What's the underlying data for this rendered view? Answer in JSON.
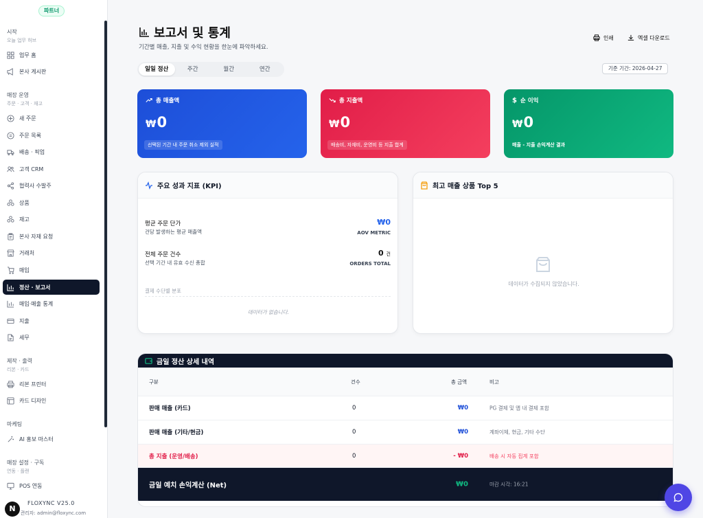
{
  "sidebar": {
    "badge": "파트너",
    "sections": [
      {
        "title": "시작",
        "sub": "오늘 업무 허브"
      },
      {
        "title": "매장 운영",
        "sub": "주문 · 고객 · 재고"
      },
      {
        "title": "제작 · 출력",
        "sub": "리본 · 카드"
      },
      {
        "title": "마케팅",
        "sub": ""
      },
      {
        "title": "매장 설정 · 구독",
        "sub": "연동 · 플랜"
      }
    ],
    "items": [
      {
        "label": "업무 홈",
        "icon": "grid-icon"
      },
      {
        "label": "본사 게시판",
        "icon": "megaphone-icon"
      },
      {
        "label": "새 주문",
        "icon": "plus-circle-icon"
      },
      {
        "label": "주문 목록",
        "icon": "list-icon"
      },
      {
        "label": "배송 · 픽업",
        "icon": "truck-icon"
      },
      {
        "label": "고객 CRM",
        "icon": "users-icon"
      },
      {
        "label": "협력사 수발주",
        "icon": "share-icon"
      },
      {
        "label": "상품",
        "icon": "boxes-icon"
      },
      {
        "label": "재고",
        "icon": "boxes-icon"
      },
      {
        "label": "본사 자재 요청",
        "icon": "clipboard-icon"
      },
      {
        "label": "거래처",
        "icon": "store-icon"
      },
      {
        "label": "매입",
        "icon": "cart-icon"
      },
      {
        "label": "정산 · 보고서",
        "icon": "bar-chart-icon"
      },
      {
        "label": "매입·매출 통계",
        "icon": "bar-chart-icon"
      },
      {
        "label": "지출",
        "icon": "card-icon"
      },
      {
        "label": "세무",
        "icon": "file-icon"
      },
      {
        "label": "리본 프린터",
        "icon": "printer-icon"
      },
      {
        "label": "카드 디자인",
        "icon": "layout-icon"
      },
      {
        "label": "AI 홍보 마스터",
        "icon": "sparkle-icon"
      },
      {
        "label": "POS 연동",
        "icon": "monitor-icon"
      }
    ],
    "active_index": 12,
    "version": "FLOXYNC V25.0",
    "admin": "관리자: admin@floxync.com",
    "logo_letter": "N"
  },
  "header": {
    "title": "보고서 및 통계",
    "subtitle": "기간별 매출, 지출 및 수익 현황을 한눈에 파악하세요.",
    "print_label": "인쇄",
    "excel_label": "엑셀 다운로드",
    "tabs": [
      "일일 정산",
      "주간",
      "월간",
      "연간"
    ],
    "active_tab": 0,
    "base_date": "기준 기간: 2026-04-27"
  },
  "kpis": [
    {
      "title": "총 매출액",
      "currency": "₩",
      "value": "0",
      "note": "선택된 기간 내 주문 취소 제외 실적",
      "color": "#1d4ed8"
    },
    {
      "title": "총 지출액",
      "currency": "₩",
      "value": "0",
      "note": "배송비, 자재비, 운영비 등 지출 합계",
      "color": "#e11d48"
    },
    {
      "title": "순 이익",
      "currency": "₩",
      "value": "0",
      "note": "매출 - 지출 손익계산 결과",
      "color": "#059669"
    }
  ],
  "kpi_card": {
    "title": "주요 성과 지표 (KPI)",
    "avg_label": "평균 주문 단가",
    "avg_sub": "건당 발생하는 평균 매출액",
    "avg_value": "₩0",
    "avg_unit": "AOV METRIC",
    "orders_label": "전체 주문 건수",
    "orders_sub": "선택 기간 내 유효 수신 총합",
    "orders_value": "0",
    "orders_suffix": "건",
    "orders_unit": "ORDERS TOTAL",
    "dist_label": "결제 수단별 분포",
    "empty": "데이터가 없습니다."
  },
  "top_products": {
    "title": "최고 매출 상품 Top 5",
    "empty": "데이터가 수집되지 않았습니다."
  },
  "table": {
    "title": "금일 정산 상세 내역",
    "headers": [
      "구분",
      "건수",
      "총 금액",
      "비고"
    ],
    "rows": [
      {
        "label": "판매 매출 (카드)",
        "count": "0",
        "amount": "₩0",
        "note": "PG 결제 및 앱 내 결제 포함"
      },
      {
        "label": "판매 매출 (기타/현금)",
        "count": "0",
        "amount": "₩0",
        "note": "계좌이체, 현금, 기타 수단"
      },
      {
        "label": "총 지출 (운영/배송)",
        "count": "0",
        "amount": "- ₩0",
        "note": "배송 시 자동 집계 포함"
      }
    ],
    "net_label": "금일 예치 손익계산 (Net)",
    "net_amount": "₩0",
    "net_note": "마감 시각: 16:21"
  }
}
